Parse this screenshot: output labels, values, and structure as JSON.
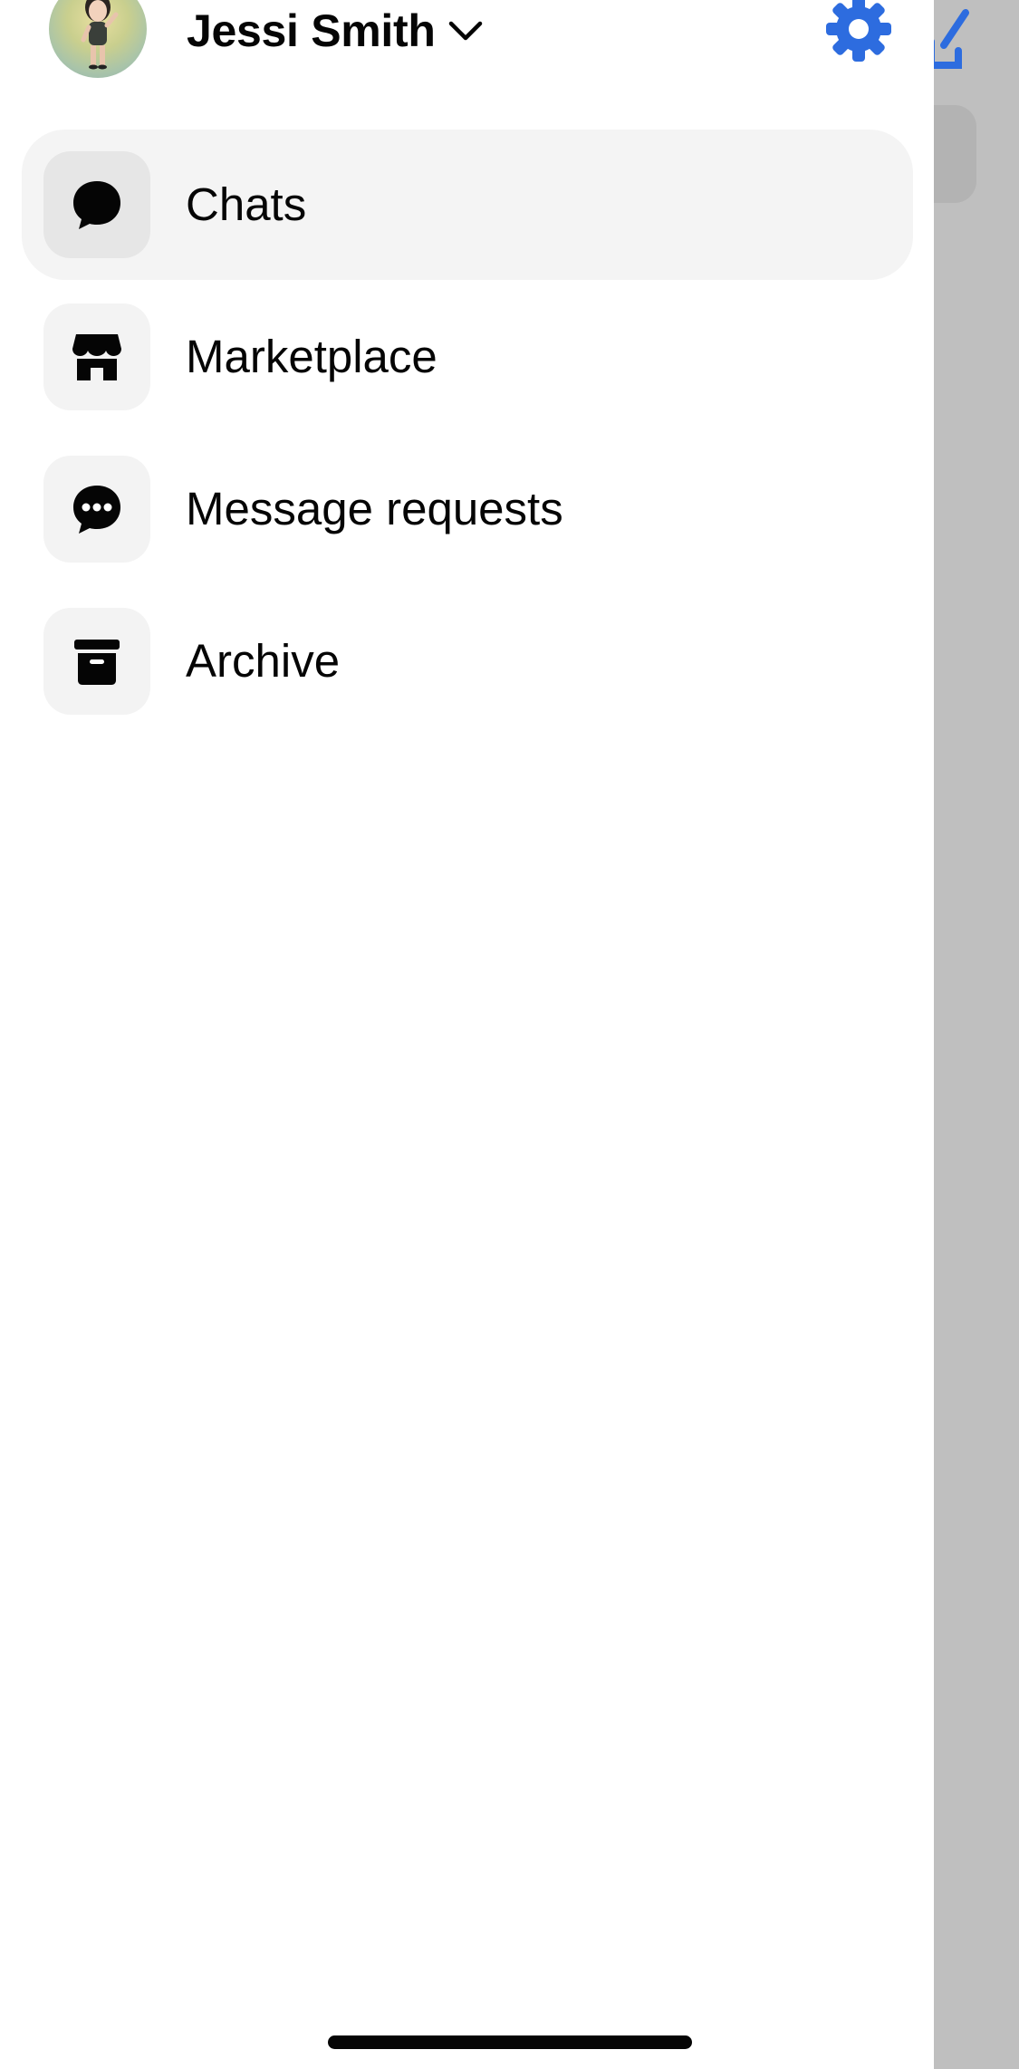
{
  "user": {
    "name": "Jessi Smith"
  },
  "icons": {
    "avatar": "avatar-image",
    "account_switch": "chevron-down-icon",
    "settings": "gear-icon",
    "compose": "compose-icon"
  },
  "colors": {
    "accent": "#2d6cdf",
    "text": "#050505",
    "active_row": "#f4f4f4"
  },
  "menu": [
    {
      "label": "Chats",
      "icon": "chat-bubble-icon",
      "active": true
    },
    {
      "label": "Marketplace",
      "icon": "storefront-icon",
      "active": false
    },
    {
      "label": "Message requests",
      "icon": "message-requests-icon",
      "active": false
    },
    {
      "label": "Archive",
      "icon": "archive-icon",
      "active": false
    }
  ]
}
